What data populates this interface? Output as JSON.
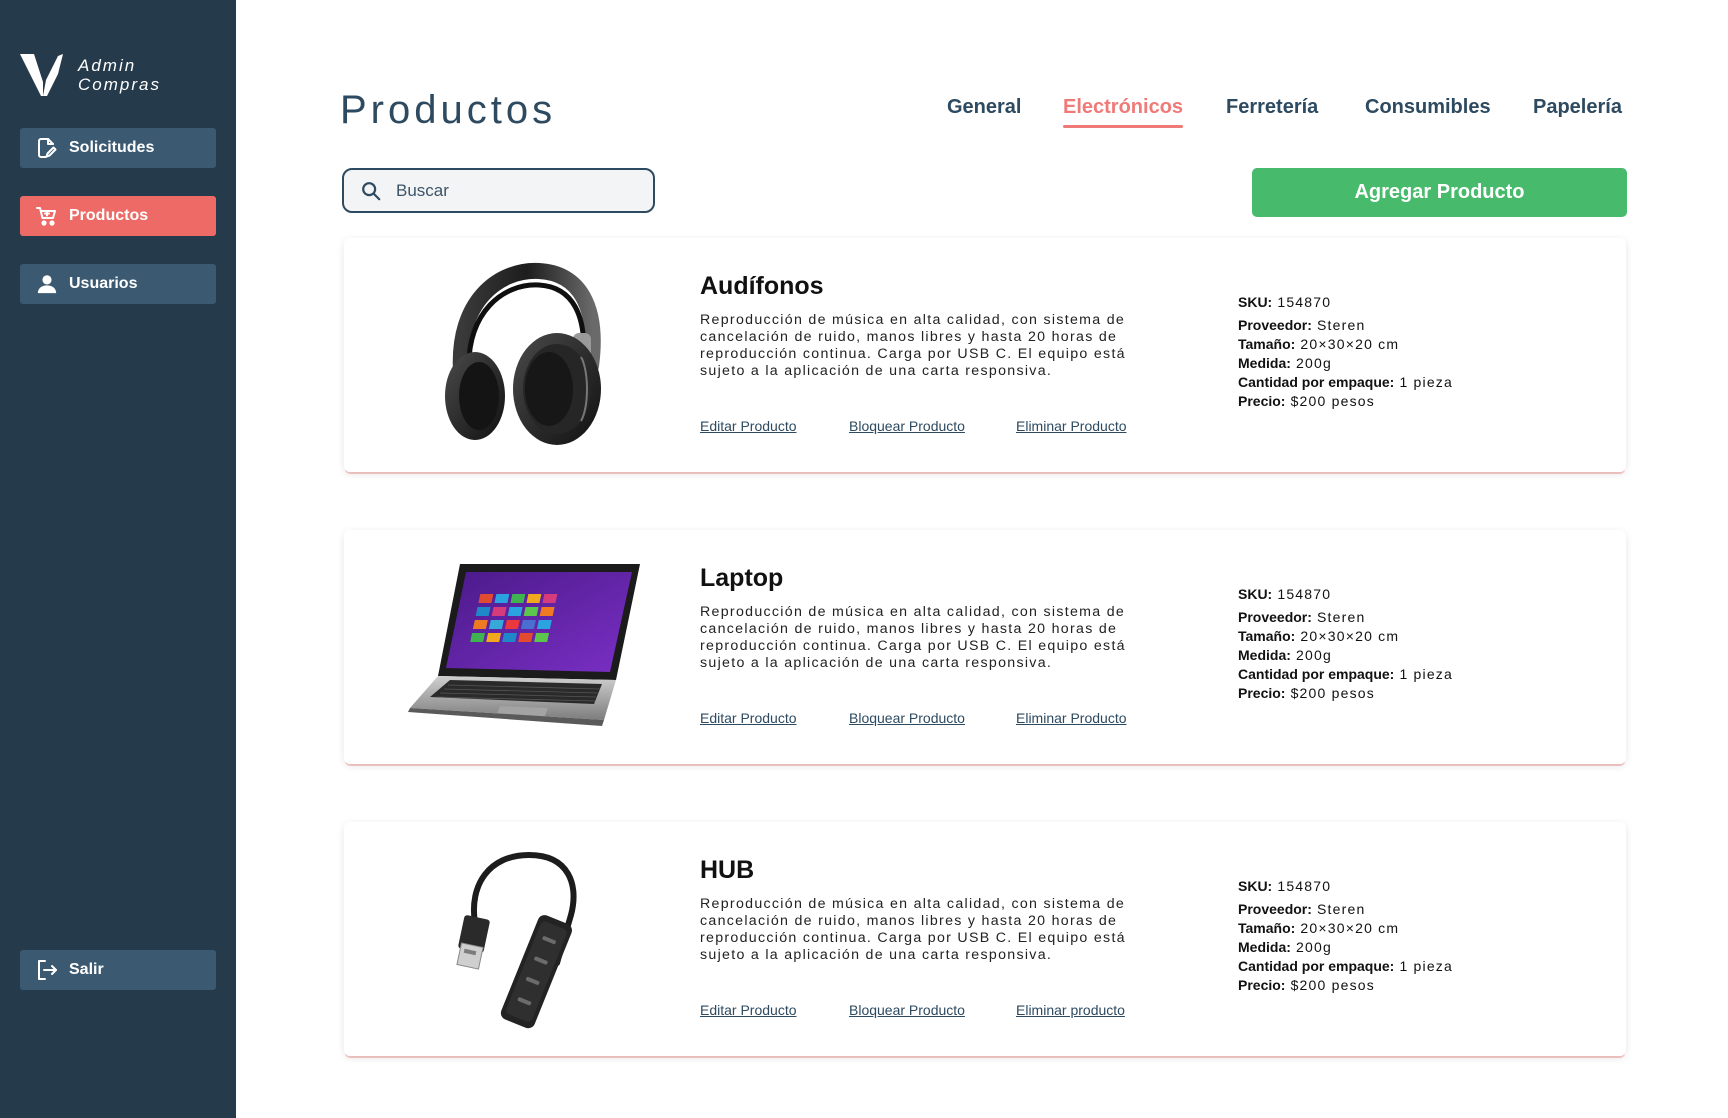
{
  "brand": {
    "line1": "Admin",
    "line2": "Compras"
  },
  "sidebar": {
    "items": [
      {
        "label": "Solicitudes",
        "icon": "edit-document-icon"
      },
      {
        "label": "Productos",
        "icon": "shopping-cart-icon",
        "active": true
      },
      {
        "label": "Usuarios",
        "icon": "user-icon"
      }
    ],
    "logout": {
      "label": "Salir",
      "icon": "logout-icon"
    }
  },
  "page": {
    "title": "Productos"
  },
  "tabs": [
    {
      "label": "General"
    },
    {
      "label": "Electrónicos",
      "active": true
    },
    {
      "label": "Ferretería"
    },
    {
      "label": "Consumibles"
    },
    {
      "label": "Papelería"
    }
  ],
  "search": {
    "placeholder": "Buscar",
    "value": ""
  },
  "add_button": {
    "label": "Agregar Producto"
  },
  "products": [
    {
      "name": "Audífonos",
      "image": "headphones",
      "description": "Reproducción de música en alta calidad, con sistema de cancelación de ruido, manos libres y hasta 20 horas de reproducción continua. Carga por USB C. El equipo está sujeto a la aplicación de una carta responsiva.",
      "actions": {
        "edit": "Editar Producto",
        "block": "Bloquear Producto",
        "delete": "Eliminar Producto"
      },
      "specs": {
        "sku_label": "SKU:",
        "sku": "154870",
        "proveedor_label": "Proveedor:",
        "proveedor": "Steren",
        "tamano_label": "Tamaño:",
        "tamano": "20×30×20 cm",
        "medida_label": "Medida:",
        "medida": "200g",
        "cantidad_label": "Cantidad por empaque:",
        "cantidad": "1 pieza",
        "precio_label": "Precio:",
        "precio": "$200 pesos"
      }
    },
    {
      "name": "Laptop",
      "image": "laptop",
      "description": "Reproducción de música en alta calidad, con sistema de cancelación de ruido, manos libres y hasta 20 horas de reproducción continua. Carga por USB C. El equipo está sujeto a la aplicación de una carta responsiva.",
      "actions": {
        "edit": "Editar Producto",
        "block": "Bloquear Producto",
        "delete": "Eliminar Producto"
      },
      "specs": {
        "sku_label": "SKU:",
        "sku": "154870",
        "proveedor_label": "Proveedor:",
        "proveedor": "Steren",
        "tamano_label": "Tamaño:",
        "tamano": "20×30×20 cm",
        "medida_label": "Medida:",
        "medida": "200g",
        "cantidad_label": "Cantidad por empaque:",
        "cantidad": "1 pieza",
        "precio_label": "Precio:",
        "precio": "$200 pesos"
      }
    },
    {
      "name": "HUB",
      "image": "usb-hub",
      "description": "Reproducción de música en alta calidad, con sistema de cancelación de ruido, manos libres y hasta 20 horas de reproducción continua. Carga por USB C. El equipo está sujeto a la aplicación de una carta responsiva.",
      "actions": {
        "edit": "Editar Producto",
        "block": "Bloquear Producto",
        "delete": "Eliminar producto"
      },
      "specs": {
        "sku_label": "SKU:",
        "sku": "154870",
        "proveedor_label": "Proveedor:",
        "proveedor": "Steren",
        "tamano_label": "Tamaño:",
        "tamano": "20×30×20 cm",
        "medida_label": "Medida:",
        "medida": "200g",
        "cantidad_label": "Cantidad por empaque:",
        "cantidad": "1 pieza",
        "precio_label": "Precio:",
        "precio": "$200 pesos"
      }
    }
  ],
  "colors": {
    "sidebar_bg": "#253a4b",
    "nav_button": "#3b5a72",
    "accent_active": "#ee6a67",
    "text_primary": "#2d4a60",
    "add_button": "#47bb6b"
  }
}
